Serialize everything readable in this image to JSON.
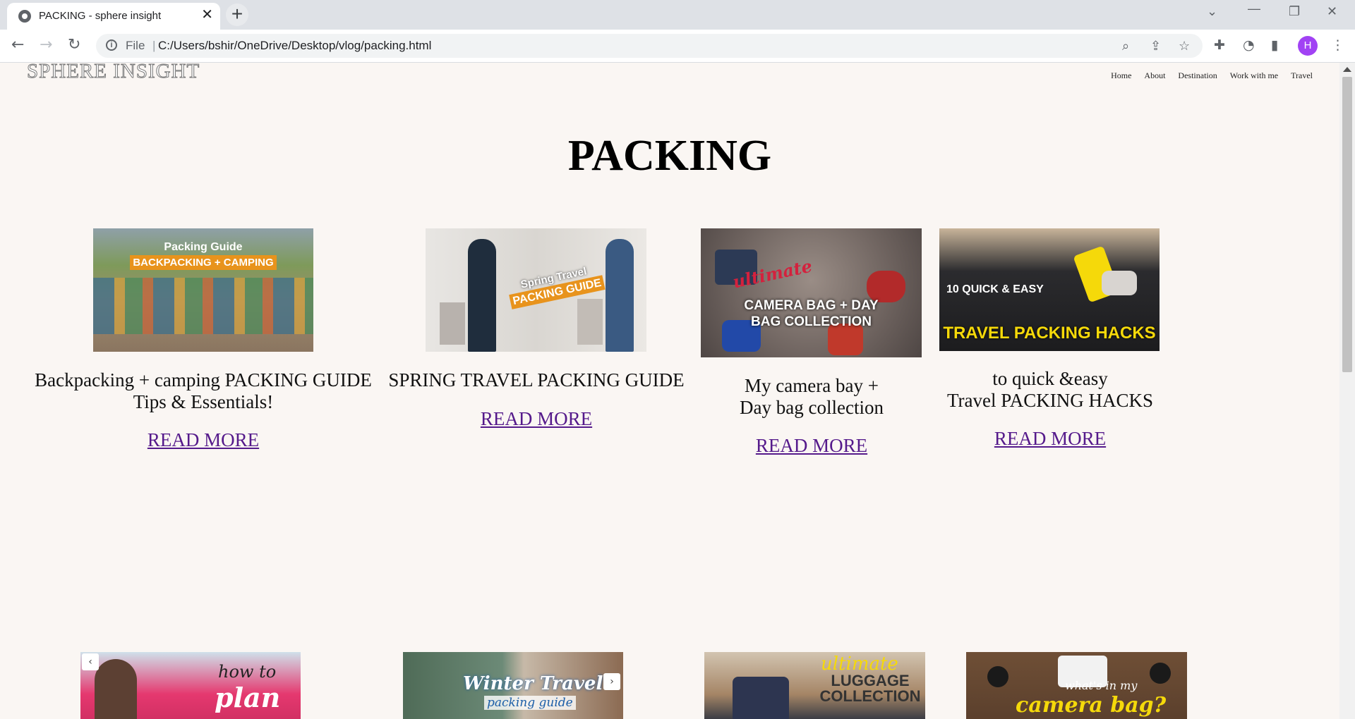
{
  "browser": {
    "tab_title": "PACKING - sphere insight",
    "tab_close": "✕",
    "new_tab": "+",
    "url_scheme": "File",
    "url_separator": "|",
    "url": "C:/Users/bshir/OneDrive/Desktop/vlog/packing.html",
    "profile_initial": "H"
  },
  "site": {
    "logo": "SPHERE INSIGHT",
    "nav": [
      "Home",
      "About",
      "Destination",
      "Work with me",
      "Travel"
    ]
  },
  "page": {
    "title": "PACKING"
  },
  "cards": [
    {
      "thumb_line1": "Packing Guide",
      "thumb_line2": "BACKPACKING + CAMPING",
      "caption": "Backpacking + camping PACKING GUIDE\nTips & Essentials!",
      "link": "READ MORE"
    },
    {
      "thumb_line1": "Spring Travel",
      "thumb_line2": "PACKING GUIDE",
      "caption": "SPRING TRAVEL PACKING GUIDE",
      "link": "READ MORE"
    },
    {
      "thumb_line1": "ultimate",
      "thumb_line2": "CAMERA BAG + DAY BAG COLLECTION",
      "caption": "My camera bay +\nDay bag collection",
      "link": "READ MORE"
    },
    {
      "thumb_line1": "10 QUICK & EASY",
      "thumb_line2": "TRAVEL PACKING HACKS",
      "caption": "to quick &easy\nTravel PACKING HACKS",
      "link": "READ MORE"
    }
  ],
  "row2": [
    {
      "thumb_line1": "how to",
      "thumb_line2": "plan"
    },
    {
      "thumb_line1": "Winter Travel",
      "thumb_line2": "packing guide"
    },
    {
      "thumb_line1": "ultimate",
      "thumb_line2": "LUGGAGE COLLECTION"
    },
    {
      "thumb_line1": "what's in my",
      "thumb_line2": "camera bag?"
    }
  ],
  "slider": {
    "prev": "‹",
    "next": "›"
  }
}
